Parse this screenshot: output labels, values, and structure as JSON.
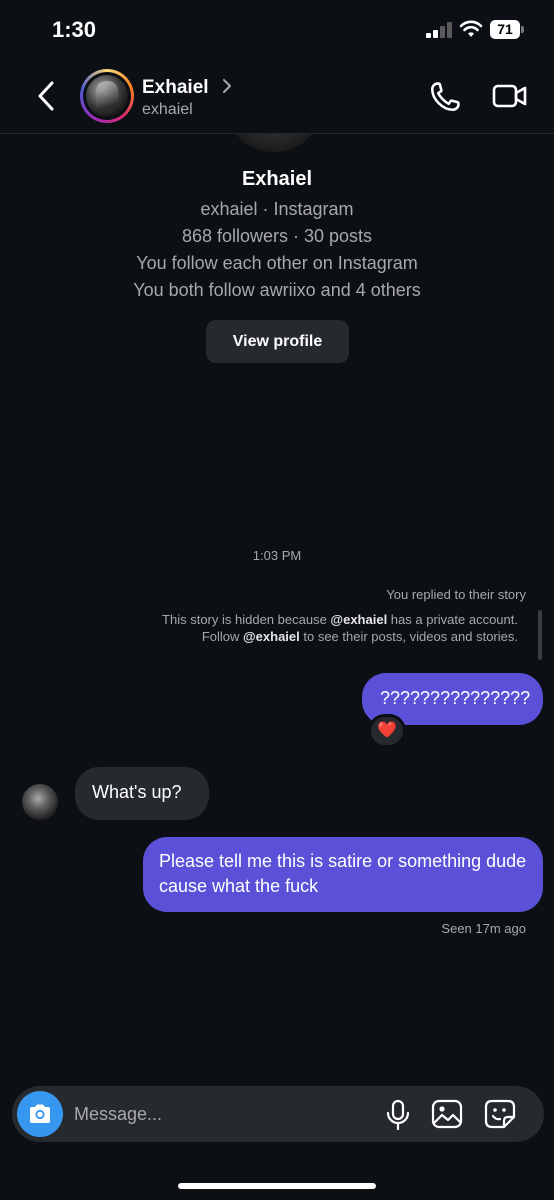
{
  "status_bar": {
    "time": "1:30",
    "battery": "71"
  },
  "header": {
    "name": "Exhaiel",
    "username": "exhaiel"
  },
  "profile": {
    "name": "Exhaiel",
    "handle_line": "exhaiel · Instagram",
    "stats_line": "868 followers · 30 posts",
    "mutual_line": "You follow each other on Instagram",
    "also_follow_line": "You both follow awriixo and 4 others",
    "view_profile_label": "View profile"
  },
  "chat": {
    "timestamp": "1:03 PM",
    "replied_label": "You replied to their story",
    "story_hidden": {
      "part1": "This story is hidden because ",
      "mention1": "@exhaiel",
      "part2": " has a private account. Follow ",
      "mention2": "@exhaiel",
      "part3": " to see their posts, videos and stories."
    },
    "messages": [
      {
        "direction": "outgoing",
        "text": "???????????????"
      },
      {
        "direction": "incoming",
        "text": "What's up?"
      },
      {
        "direction": "outgoing",
        "text": "Please tell me this is satire or something dude cause what the fuck"
      }
    ],
    "reaction": "❤️",
    "seen_label": "Seen 17m ago"
  },
  "composer": {
    "placeholder": "Message..."
  },
  "icons": [
    "back-icon",
    "chevron-right-icon",
    "phone-icon",
    "video-camera-icon",
    "camera-icon",
    "microphone-icon",
    "gallery-icon",
    "sticker-icon"
  ]
}
